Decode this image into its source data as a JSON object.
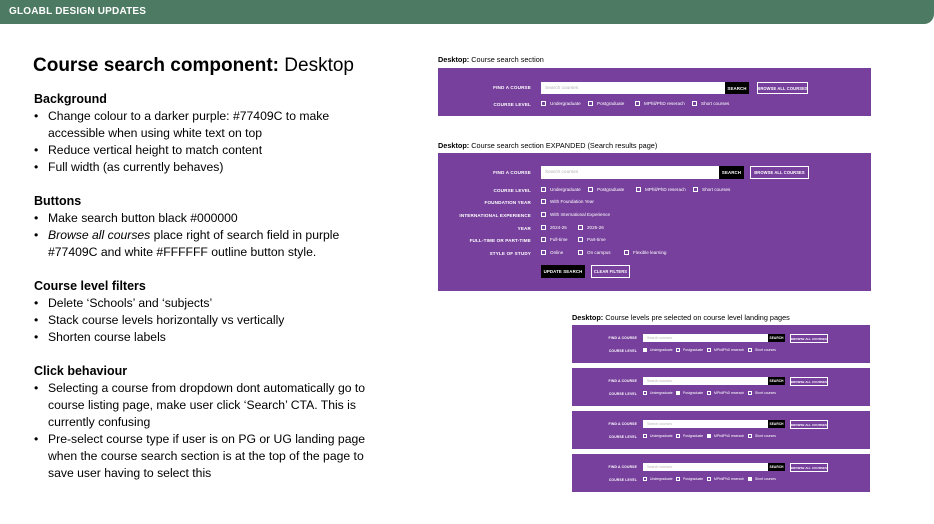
{
  "topbar": {
    "title": "GLOABL DESIGN UPDATES"
  },
  "heading": {
    "bold": "Course search component:",
    "light": "Desktop"
  },
  "notes": [
    {
      "title": "Background",
      "items": [
        "Change colour to a darker purple: #77409C to make accessible when using white text on top",
        "Reduce vertical height to match content",
        "Full width (as currently behaves)"
      ]
    },
    {
      "title": "Buttons",
      "items": [
        "Make search button black #000000",
        "Browse all courses place right of search field in purple #77409C and white #FFFFFF outline button style."
      ]
    },
    {
      "title": "Course level filters",
      "items": [
        "Delete ‘Schools’ and ‘subjects’",
        "Stack course levels horizontally vs vertically",
        "Shorten course labels"
      ]
    },
    {
      "title": "Click behaviour",
      "items": [
        "Selecting a course from dropdown dont automatically go to course listing page, make user click ‘Search’ CTA. This is currently confusing",
        "Pre-select course type if user is on PG or UG landing page when the course search section is at the top of the page to save user having to select this"
      ]
    }
  ],
  "note_emphasis": "Browse all courses",
  "colors": {
    "topbar": "#4d7a62",
    "panel": "#77409c",
    "button": "#000000"
  },
  "panel1": {
    "caption_bold": "Desktop:",
    "caption": "Course search section",
    "find_label": "FIND A COURSE",
    "placeholder": "Search courses",
    "search": "SEARCH",
    "browse": "BROWSE ALL COURSES",
    "level_label": "COURSE LEVEL",
    "levels": [
      "Undergraduate",
      "Postgraduate",
      "MPhil/PhD reserach",
      "Short courses"
    ]
  },
  "panel2": {
    "caption_bold": "Desktop:",
    "caption": "Course search section EXPANDED (Search results page)",
    "find_label": "FIND A COURSE",
    "placeholder": "Search courses",
    "search": "SEARCH",
    "browse": "BROWSE ALL COURSES",
    "level_label": "COURSE LEVEL",
    "levels": [
      "Undergraduate",
      "Postgraduate",
      "MPhil/PhD reserach",
      "Short courses"
    ],
    "foundation_label": "FOUNDATION YEAR",
    "foundation_option": "With Foundation Year",
    "intl_label": "INTERNATIONAL EXPERIENCE",
    "intl_option": "With International Experience",
    "year_label": "YEAR",
    "years": [
      "2024-25",
      "2025-26"
    ],
    "mode_label": "FULL-TIME OR PART-TIME",
    "modes": [
      "Full-time",
      "Part-time"
    ],
    "style_label": "STYLE OF STUDY",
    "styles": [
      "Online",
      "On campus",
      "Flexible learning"
    ],
    "update": "UPDATE SEARCH",
    "clear": "CLEAR FILTERS"
  },
  "panel3": {
    "caption_bold": "Desktop:",
    "caption": "Course levels pre selected on course level landing pages",
    "find_label": "FIND A COURSE",
    "placeholder": "Search courses",
    "search": "SEARCH",
    "browse": "BROWSE ALL COURSES",
    "level_label": "COURSE LEVEL",
    "levels": [
      "Undergraduate",
      "Postgraduate",
      "MPhil/PhD reserach",
      "Short courses"
    ],
    "selected": [
      0,
      1,
      2,
      3
    ]
  }
}
